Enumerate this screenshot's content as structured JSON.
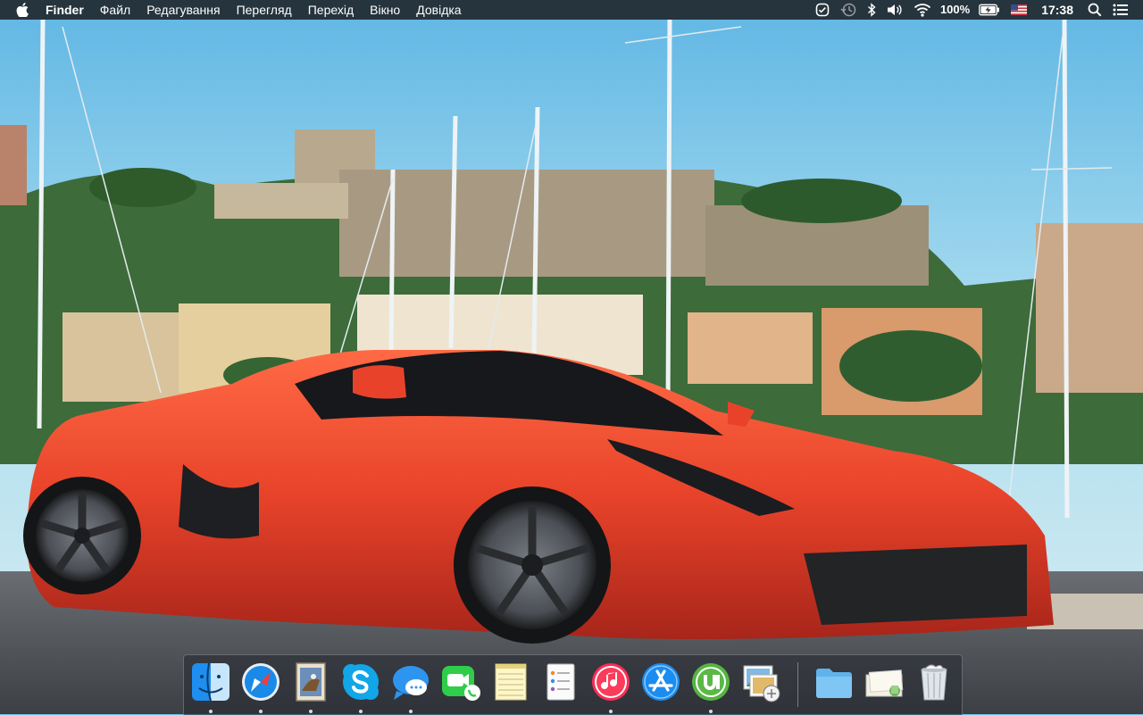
{
  "menubar": {
    "apple_icon": "apple-logo-icon",
    "app_name": "Finder",
    "menus": [
      "Файл",
      "Редагування",
      "Перегляд",
      "Перехід",
      "Вікно",
      "Довідка"
    ],
    "status": {
      "icons": [
        "clipboard-check-icon",
        "time-machine-icon",
        "bluetooth-icon",
        "volume-icon",
        "wifi-icon"
      ],
      "battery_percent": "100%",
      "battery_level": 1.0,
      "input_source": "us-flag-icon",
      "clock": "17:38",
      "search_icon": "spotlight-search-icon",
      "notifications_icon": "notification-center-icon"
    }
  },
  "dock": {
    "apps": [
      {
        "name": "Finder",
        "icon": "finder-icon",
        "running": true
      },
      {
        "name": "Safari",
        "icon": "safari-icon",
        "running": true
      },
      {
        "name": "Preview",
        "icon": "preview-icon",
        "running": true
      },
      {
        "name": "Skype",
        "icon": "skype-icon",
        "running": true
      },
      {
        "name": "Messages",
        "icon": "messages-icon",
        "running": true
      },
      {
        "name": "FaceTime",
        "icon": "facetime-icon",
        "running": false
      },
      {
        "name": "Notes",
        "icon": "notes-icon",
        "running": false
      },
      {
        "name": "Reminders",
        "icon": "reminders-icon",
        "running": false
      },
      {
        "name": "iTunes",
        "icon": "itunes-icon",
        "running": true
      },
      {
        "name": "App Store",
        "icon": "app-store-icon",
        "running": false
      },
      {
        "name": "uTorrent",
        "icon": "utorrent-icon",
        "running": true
      },
      {
        "name": "Photo Booth",
        "icon": "photos-icon",
        "running": false
      }
    ],
    "stacks": [
      {
        "name": "Applications",
        "icon": "folder-icon"
      },
      {
        "name": "Downloads",
        "icon": "downloads-stack-icon"
      },
      {
        "name": "Trash",
        "icon": "trash-icon"
      }
    ]
  },
  "colors": {
    "sky": "#7cc8ec",
    "car_red": "#e8432a",
    "menubar_bg": "#1c1e22"
  }
}
